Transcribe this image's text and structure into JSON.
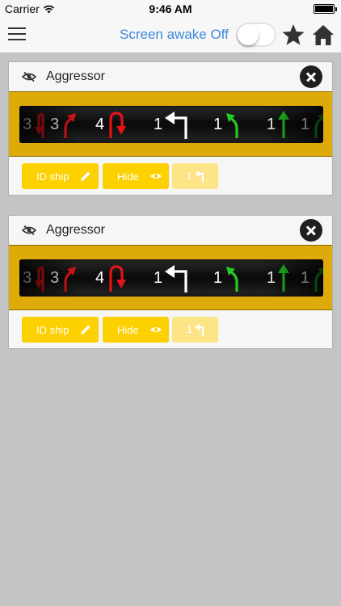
{
  "status_bar": {
    "carrier": "Carrier",
    "time": "9:46 AM"
  },
  "nav": {
    "screen_awake_label": "Screen awake Off",
    "screen_awake_on": false,
    "icons": [
      "menu-icon",
      "star-icon",
      "home-icon"
    ],
    "accent_color": "#3e88d8"
  },
  "cards": [
    {
      "title": "Aggressor",
      "maneuvers": [
        {
          "speed": "3",
          "move": "koiogran-left",
          "color": "red"
        },
        {
          "speed": "3",
          "move": "bank-right",
          "color": "red"
        },
        {
          "speed": "4",
          "move": "u-turn",
          "color": "red"
        },
        {
          "speed": "1",
          "move": "turn-left",
          "color": "white"
        },
        {
          "speed": "1",
          "move": "bank-left",
          "color": "green"
        },
        {
          "speed": "1",
          "move": "straight",
          "color": "green"
        },
        {
          "speed": "1",
          "move": "bank-right",
          "color": "green"
        }
      ],
      "actions": {
        "id_ship": "ID ship",
        "hide": "Hide",
        "turn_value": "1"
      }
    },
    {
      "title": "Aggressor",
      "maneuvers": [
        {
          "speed": "3",
          "move": "koiogran-left",
          "color": "red"
        },
        {
          "speed": "3",
          "move": "bank-right",
          "color": "red"
        },
        {
          "speed": "4",
          "move": "u-turn",
          "color": "red"
        },
        {
          "speed": "1",
          "move": "turn-left",
          "color": "white"
        },
        {
          "speed": "1",
          "move": "bank-left",
          "color": "green"
        },
        {
          "speed": "1",
          "move": "straight",
          "color": "green"
        },
        {
          "speed": "1",
          "move": "bank-right",
          "color": "green"
        }
      ],
      "actions": {
        "id_ship": "ID ship",
        "hide": "Hide",
        "turn_value": "1"
      }
    }
  ],
  "colors": {
    "band": "#deaa0a",
    "button": "#fdd000",
    "red": "#e2141a",
    "green": "#22cc22",
    "white": "#ffffff"
  }
}
